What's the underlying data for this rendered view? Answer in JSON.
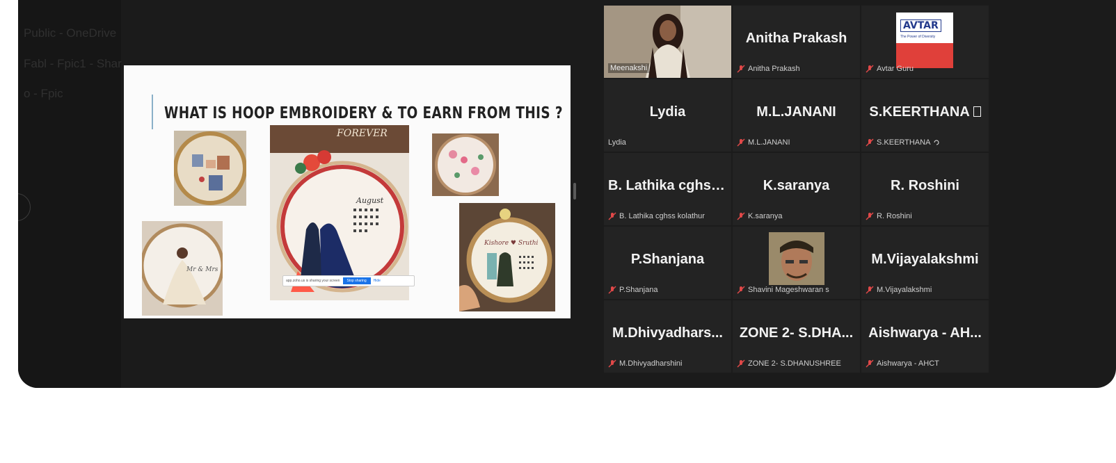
{
  "sidebar": {
    "faded_lines": [
      " Public - OneDrive",
      "Fabl - Fpic1 - Shar",
      "o - Fpic"
    ]
  },
  "slide": {
    "title": "WHAT IS HOOP EMBROIDERY & TO EARN FROM THIS ?",
    "hoop_text_forever": "FOREVER",
    "hoop_text_calendar": "August",
    "hoop_text_names": "Kishore ♥ Sruthi",
    "share_banner": {
      "message": "app.zoho.us is sharing your screen",
      "stop_label": "Stop sharing",
      "hide_label": "Hide"
    }
  },
  "participants": [
    {
      "display": "",
      "label": "Meenakshi",
      "video": true,
      "muted": false
    },
    {
      "display": "Anitha Prakash",
      "label": "Anitha Prakash",
      "muted": true
    },
    {
      "display": "",
      "label": "Avtar Guru",
      "logo": true,
      "muted": true
    },
    {
      "display": "Lydia",
      "label": "Lydia",
      "muted": false
    },
    {
      "display": "M.L.JANANI",
      "label": "M.L.JANANI",
      "muted": true
    },
    {
      "display": "S.KEERTHANA ",
      "label": "S.KEERTHANA ",
      "muted": true
    },
    {
      "display": "B. Lathika cghss...",
      "label": "B. Lathika cghss kolathur",
      "muted": true
    },
    {
      "display": "K.saranya",
      "label": "K.saranya",
      "muted": true
    },
    {
      "display": "R. Roshini",
      "label": "R. Roshini",
      "muted": true
    },
    {
      "display": "P.Shanjana",
      "label": "P.Shanjana",
      "muted": true
    },
    {
      "display": "",
      "label": "Shavini Mageshwaran s",
      "photo": true,
      "muted": true
    },
    {
      "display": "M.Vijayalakshmi",
      "label": "M.Vijayalakshmi",
      "muted": true
    },
    {
      "display": "M.Dhivyadhars...",
      "label": "M.Dhivyadharshini",
      "muted": true
    },
    {
      "display": "ZONE 2- S.DHA...",
      "label": "ZONE 2- S.DHANUSHREE",
      "muted": true
    },
    {
      "display": "Aishwarya - AH...",
      "label": "Aishwarya - AHCT",
      "muted": true
    }
  ],
  "logo": {
    "brand": "AVTAR",
    "tagline": "The Power of Diversity"
  },
  "colors": {
    "active_speaker": "#d6de4e",
    "muted_icon": "#e04848",
    "background": "#1b1b1b"
  }
}
